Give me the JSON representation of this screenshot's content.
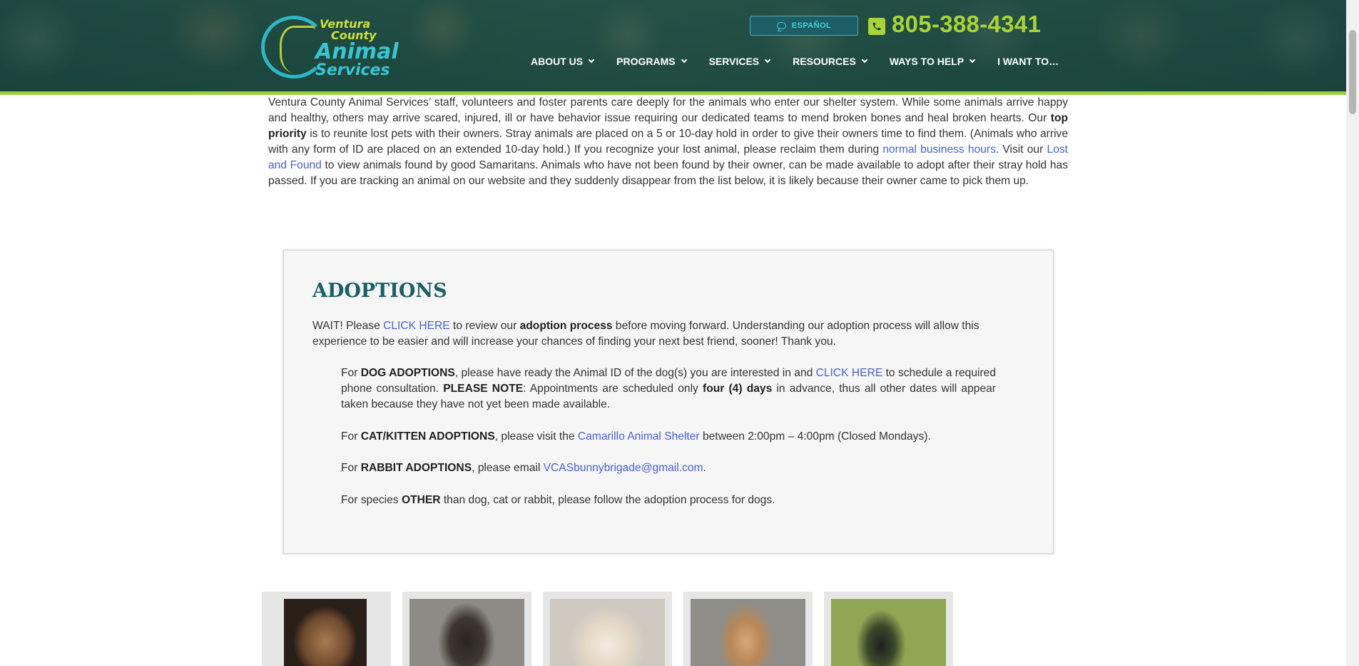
{
  "header": {
    "logo": {
      "line1": "Ventura",
      "line2": "County",
      "line3": "Animal",
      "line4": "Services"
    },
    "espanol_label": "ESPAÑOL",
    "phone": "805-388-4341",
    "nav": [
      {
        "label": "ABOUT US"
      },
      {
        "label": "PROGRAMS"
      },
      {
        "label": "SERVICES"
      },
      {
        "label": "RESOURCES"
      },
      {
        "label": "WAYS TO HELP"
      },
      {
        "label": "I WANT TO…"
      }
    ]
  },
  "intro": {
    "t1": "Ventura County Animal Services’ staff, volunteers and foster parents care deeply for the animals who enter our shelter system.  While some animals arrive happy and healthy, others may arrive scared, injured, ill or have behavior issue requiring our dedicated teams to mend broken bones and heal broken hearts.  Our ",
    "b1": "top priority",
    "t2": " is to reunite lost pets with their owners.  Stray animals are placed on a 5 or 10-day hold in order to give their owners time to find them. (Animals who arrive with any form of ID are placed on an extended 10-day hold.)  If you recognize your lost animal, please reclaim them during ",
    "link1": "normal business hours",
    "t3": ".  Visit our ",
    "link2": "Lost and Found",
    "t4": " to view animals found by good Samaritans.  Animals who have not been found by their owner, can be made available to adopt after their stray hold has passed.  If you are tracking an animal on our website and they suddenly disappear from the list below, it is likely because their owner came to pick them up."
  },
  "adoptions": {
    "title": "ADOPTIONS",
    "p1": {
      "t1": "WAIT!  Please ",
      "link": "CLICK HERE",
      "t2": " to review our ",
      "b": "adoption process",
      "t3": " before moving forward.  Understanding our adoption process will allow this experience to be easier and will increase your chances of finding your next best friend, sooner!  Thank you."
    },
    "dog": {
      "t1": "For ",
      "b1": "DOG ADOPTIONS",
      "t2": ", please have ready the Animal ID of the dog(s) you are interested in and ",
      "link": "CLICK HERE",
      "t3": " to schedule a required phone consultation.  ",
      "b2": "PLEASE NOTE",
      "t4": ":  Appointments are scheduled only ",
      "b3": "four (4) days",
      "t5": " in advance, thus all other dates will appear taken because they have not yet been made available."
    },
    "cat": {
      "t1": "For ",
      "b": "CAT/KITTEN ADOPTIONS",
      "t2": ", please visit the ",
      "link": "Camarillo Animal Shelter",
      "t3": " between 2:00pm – 4:00pm (Closed Mondays)."
    },
    "rabbit": {
      "t1": "For ",
      "b": "RABBIT ADOPTIONS",
      "t2": ", please email ",
      "link": "VCASbunnybrigade@gmail.com",
      "t3": "."
    },
    "other": {
      "t1": "For species ",
      "b": "OTHER",
      "t2": " than dog, cat or rabbit, please follow the adoption process for dogs."
    }
  },
  "colors": {
    "header_accent": "#9ccf3f",
    "phone_green": "#a8d43a",
    "espanol_teal": "#46d2d9",
    "title_teal": "#1d5f64",
    "link_blue": "#4a60d8"
  },
  "cards": [
    {
      "name": "animal-card-1"
    },
    {
      "name": "animal-card-2"
    },
    {
      "name": "animal-card-3"
    },
    {
      "name": "animal-card-4"
    },
    {
      "name": "animal-card-5"
    }
  ]
}
